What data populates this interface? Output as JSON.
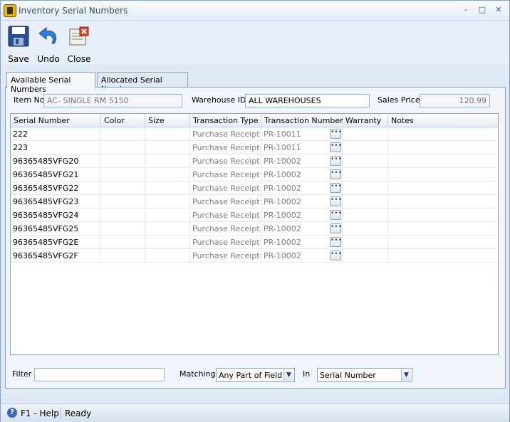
{
  "window": {
    "title": "Inventory Serial Numbers",
    "minimize": "–",
    "maximize": "□",
    "close": "✕"
  },
  "toolbar": {
    "save_label": "Save",
    "undo_label": "Undo",
    "close_label": "Close"
  },
  "tabs": [
    {
      "label": "Available Serial Numbers",
      "active": true
    },
    {
      "label": "Allocated Serial Numbers",
      "active": false
    }
  ],
  "header": {
    "item_no_label": "Item No",
    "item_no_value": "AC- SINGLE RM 5150",
    "warehouse_label": "Warehouse ID",
    "warehouse_value": "ALL WAREHOUSES",
    "sales_price_label": "Sales Price",
    "sales_price_value": "120.99"
  },
  "grid": {
    "columns": [
      "Serial Number",
      "Color",
      "Size",
      "Transaction Type",
      "Transaction Number",
      "Warranty",
      "Notes"
    ],
    "rows": [
      {
        "serial": "222",
        "color": "",
        "size": "",
        "type": "Purchase Receipt",
        "number": "PR-10011",
        "warranty": "",
        "notes": ""
      },
      {
        "serial": "223",
        "color": "",
        "size": "",
        "type": "Purchase Receipt",
        "number": "PR-10011",
        "warranty": "",
        "notes": ""
      },
      {
        "serial": "96365485VFG20",
        "color": "",
        "size": "",
        "type": "Purchase Receipt",
        "number": "PR-10002",
        "warranty": "",
        "notes": ""
      },
      {
        "serial": "96365485VFG21",
        "color": "",
        "size": "",
        "type": "Purchase Receipt",
        "number": "PR-10002",
        "warranty": "",
        "notes": ""
      },
      {
        "serial": "96365485VFG22",
        "color": "",
        "size": "",
        "type": "Purchase Receipt",
        "number": "PR-10002",
        "warranty": "",
        "notes": ""
      },
      {
        "serial": "96365485VFG23",
        "color": "",
        "size": "",
        "type": "Purchase Receipt",
        "number": "PR-10002",
        "warranty": "",
        "notes": ""
      },
      {
        "serial": "96365485VFG24",
        "color": "",
        "size": "",
        "type": "Purchase Receipt",
        "number": "PR-10002",
        "warranty": "",
        "notes": ""
      },
      {
        "serial": "96365485VFG25",
        "color": "",
        "size": "",
        "type": "Purchase Receipt",
        "number": "PR-10002",
        "warranty": "",
        "notes": ""
      },
      {
        "serial": "96365485VFG2E",
        "color": "",
        "size": "",
        "type": "Purchase Receipt",
        "number": "PR-10002",
        "warranty": "",
        "notes": ""
      },
      {
        "serial": "96365485VFG2F",
        "color": "",
        "size": "",
        "type": "Purchase Receipt",
        "number": "PR-10002",
        "warranty": "",
        "notes": ""
      }
    ],
    "ellipsis_label": "•••"
  },
  "filter": {
    "filter_label": "Filter",
    "filter_value": "",
    "matching_label": "Matching",
    "matching_value": "Any Part of Field",
    "in_label": "In",
    "in_value": "Serial Number"
  },
  "status": {
    "help": "F1 - Help",
    "state": "Ready"
  },
  "colors": {
    "accent": "#3b66b5",
    "window_bg": "#dfe9f5",
    "dim_text": "#808080"
  }
}
